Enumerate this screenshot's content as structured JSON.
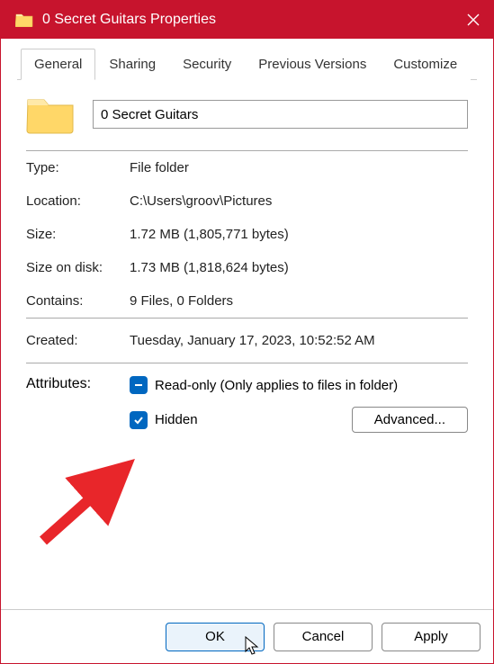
{
  "window": {
    "title": "0 Secret Guitars Properties"
  },
  "tabs": {
    "general": "General",
    "sharing": "Sharing",
    "security": "Security",
    "previous": "Previous Versions",
    "customize": "Customize"
  },
  "name": "0 Secret Guitars",
  "props": {
    "type_label": "Type:",
    "type_value": "File folder",
    "location_label": "Location:",
    "location_value": "C:\\Users\\groov\\Pictures",
    "size_label": "Size:",
    "size_value": "1.72 MB (1,805,771 bytes)",
    "sizeondisk_label": "Size on disk:",
    "sizeondisk_value": "1.73 MB (1,818,624 bytes)",
    "contains_label": "Contains:",
    "contains_value": "9 Files, 0 Folders",
    "created_label": "Created:",
    "created_value": "Tuesday, January 17, 2023, 10:52:52 AM",
    "attributes_label": "Attributes:",
    "readonly_label": "Read-only (Only applies to files in folder)",
    "hidden_label": "Hidden",
    "advanced_label": "Advanced..."
  },
  "footer": {
    "ok": "OK",
    "cancel": "Cancel",
    "apply": "Apply"
  }
}
